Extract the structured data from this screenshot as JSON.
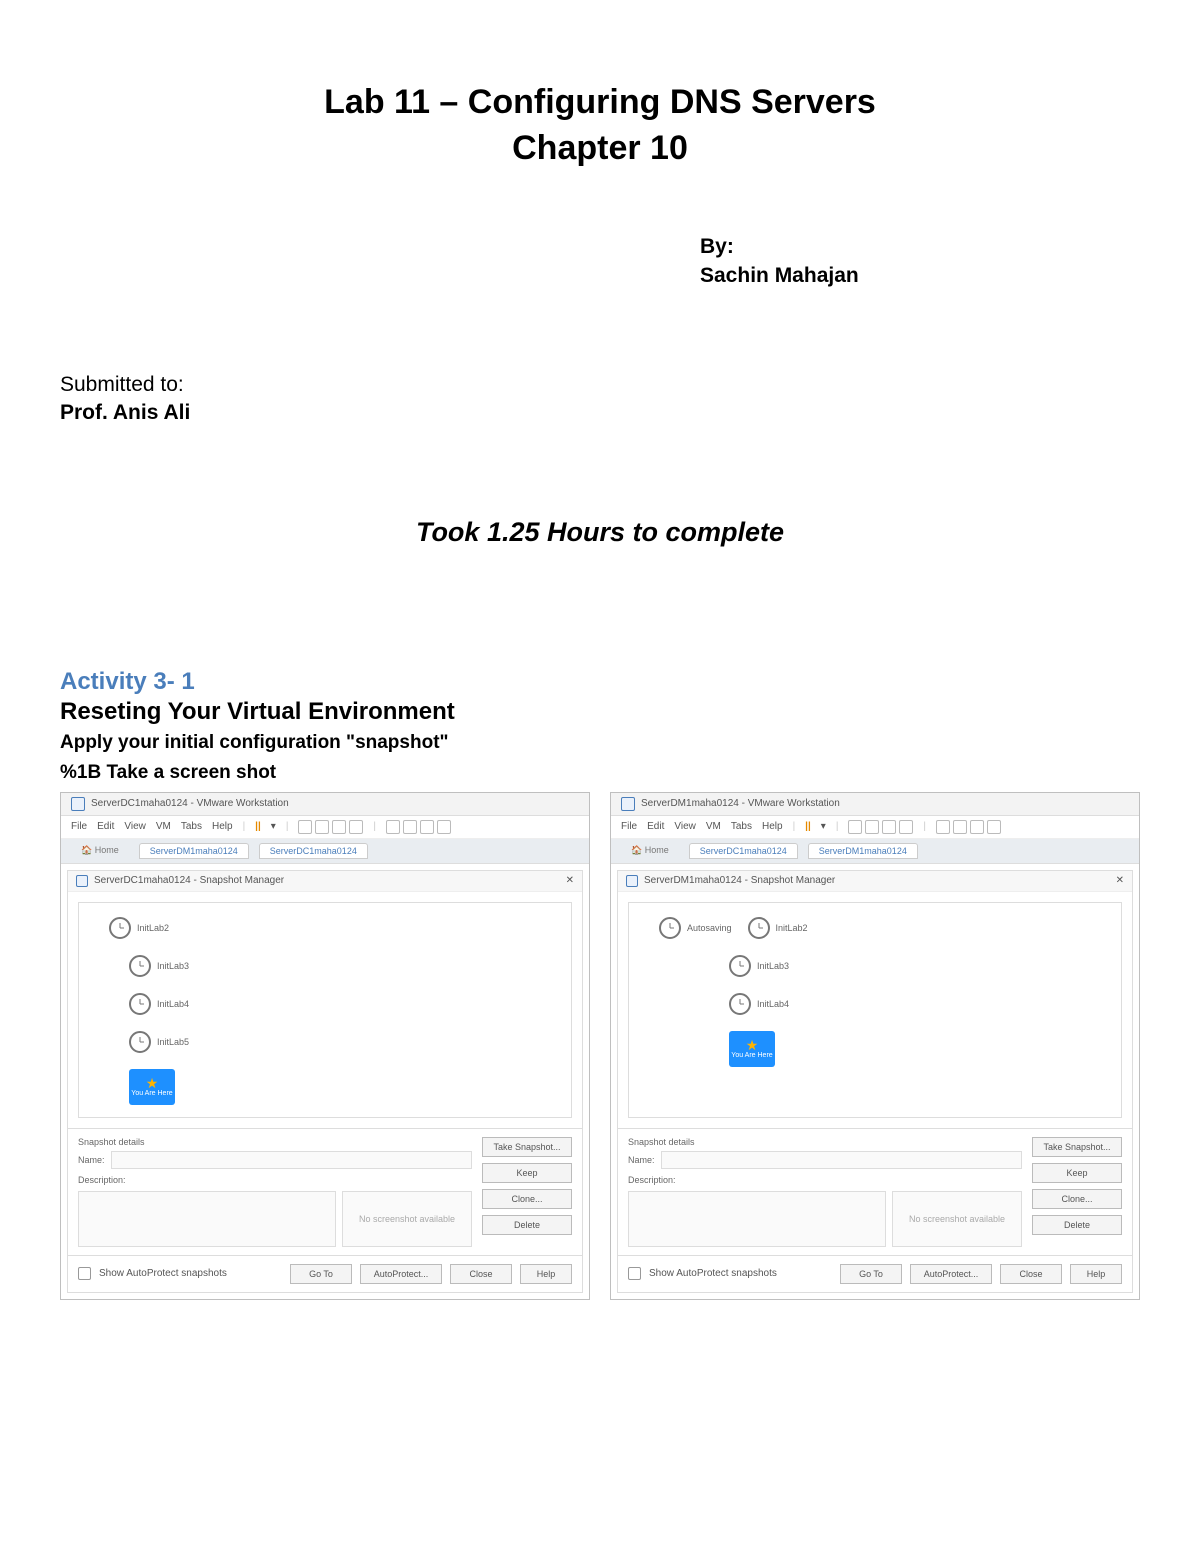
{
  "header": {
    "title_line1": "Lab 11 – Configuring DNS Servers",
    "title_line2": "Chapter 10"
  },
  "byline": {
    "by_label": "By:",
    "author": "Sachin Mahajan"
  },
  "submitted": {
    "label": "Submitted to:",
    "name": "Prof. Anis Ali"
  },
  "duration": "Took 1.25 Hours to complete",
  "activity": {
    "number": "Activity 3- 1",
    "title": "Reseting Your Virtual Environment",
    "instruction1": "Apply your initial configuration \"snapshot\"",
    "instruction2": "%1B Take a screen shot"
  },
  "screenshots": {
    "left": {
      "window_title": "ServerDC1maha0124 - VMware Workstation",
      "menu": {
        "file": "File",
        "edit": "Edit",
        "view": "View",
        "vm": "VM",
        "tabs": "Tabs",
        "help": "Help"
      },
      "tabs": {
        "home": "Home",
        "tab1": "ServerDM1maha0124",
        "tab2": "ServerDC1maha0124"
      },
      "dialog_title": "ServerDC1maha0124 - Snapshot Manager",
      "snapshots": [
        "InitLab2",
        "InitLab3",
        "InitLab4",
        "InitLab5"
      ],
      "you_are_here": "You Are Here",
      "details_label": "Snapshot details",
      "name_label": "Name:",
      "desc_label": "Description:",
      "no_screenshot": "No screenshot available",
      "buttons": {
        "take": "Take Snapshot...",
        "keep": "Keep",
        "clone": "Clone...",
        "delete": "Delete"
      },
      "footer": {
        "show": "Show AutoProtect snapshots",
        "goto": "Go To",
        "auto": "AutoProtect...",
        "close": "Close",
        "help": "Help"
      }
    },
    "right": {
      "window_title": "ServerDM1maha0124 - VMware Workstation",
      "menu": {
        "file": "File",
        "edit": "Edit",
        "view": "View",
        "vm": "VM",
        "tabs": "Tabs",
        "help": "Help"
      },
      "tabs": {
        "home": "Home",
        "tab1": "ServerDC1maha0124",
        "tab2": "ServerDM1maha0124"
      },
      "dialog_title": "ServerDM1maha0124 - Snapshot Manager",
      "snapshots_row": [
        "Autosaving",
        "InitLab2"
      ],
      "snapshots": [
        "InitLab3",
        "InitLab4"
      ],
      "you_are_here": "You Are Here",
      "details_label": "Snapshot details",
      "name_label": "Name:",
      "desc_label": "Description:",
      "no_screenshot": "No screenshot available",
      "buttons": {
        "take": "Take Snapshot...",
        "keep": "Keep",
        "clone": "Clone...",
        "delete": "Delete"
      },
      "footer": {
        "show": "Show AutoProtect snapshots",
        "goto": "Go To",
        "auto": "AutoProtect...",
        "close": "Close",
        "help": "Help"
      }
    }
  }
}
